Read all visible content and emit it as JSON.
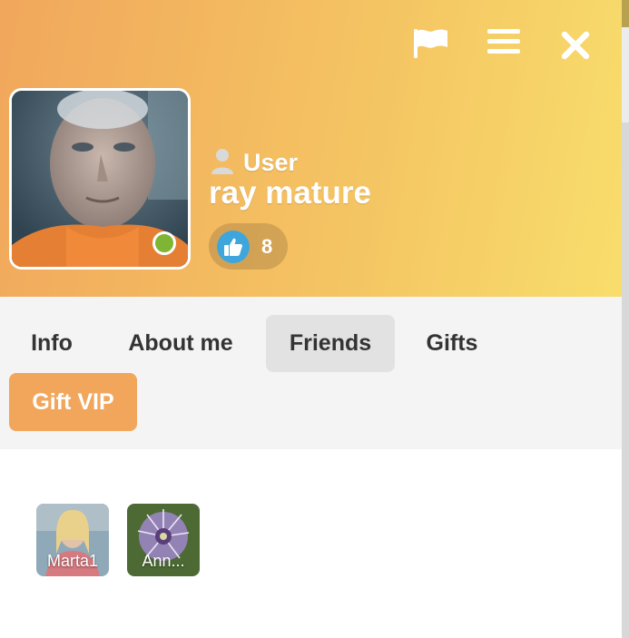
{
  "profile": {
    "role_label": "User",
    "username": "ray mature",
    "likes_count": "8",
    "online": true
  },
  "header": {
    "actions": [
      {
        "name": "report",
        "icon": "flag-icon"
      },
      {
        "name": "menu",
        "icon": "hamburger-menu-icon"
      },
      {
        "name": "close",
        "icon": "close-icon"
      }
    ]
  },
  "tabs": [
    {
      "label": "Info",
      "active": false
    },
    {
      "label": "About me",
      "active": false
    },
    {
      "label": "Friends",
      "active": true
    },
    {
      "label": "Gifts",
      "active": false
    }
  ],
  "gift_vip_label": "Gift VIP",
  "friends": [
    {
      "name": "Marta1"
    },
    {
      "name": "Ann..."
    }
  ],
  "colors": {
    "header_gradient_start": "#f1a75c",
    "header_gradient_end": "#f8dd6c",
    "accent_orange": "#f2a65b",
    "online_green": "#7fb534",
    "like_blue": "#3ea6dc",
    "tab_active_bg": "#e2e2e2",
    "tabs_bg": "#f4f4f4"
  }
}
